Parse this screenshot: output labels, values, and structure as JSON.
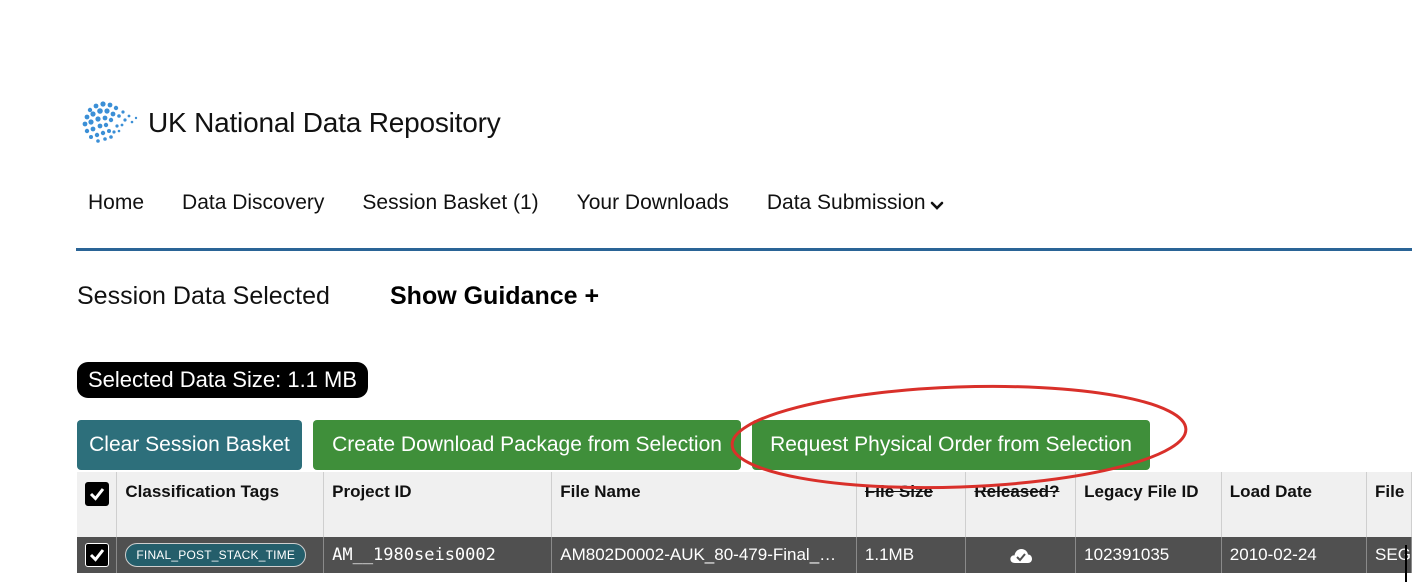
{
  "brand": {
    "title": "UK National Data Repository",
    "logo_icon": "nda-dots-logo-icon"
  },
  "nav": {
    "items": [
      {
        "label": "Home"
      },
      {
        "label": "Data Discovery"
      },
      {
        "label": "Session Basket (1)"
      },
      {
        "label": "Your Downloads"
      },
      {
        "label": "Data Submission"
      }
    ],
    "accent": "#2a6496"
  },
  "section": {
    "title": "Session Data Selected",
    "guidance": "Show Guidance +",
    "selected_size": "Selected Data Size: 1.1 MB"
  },
  "buttons": {
    "clear": "Clear Session Basket",
    "create": "Create Download Package from Selection",
    "physical": "Request Physical Order from Selection"
  },
  "table": {
    "headers": [
      "Classification Tags",
      "Project ID",
      "File Name",
      "File Size",
      "Released?",
      "Legacy File ID",
      "Load Date",
      "File"
    ],
    "rows": [
      {
        "checked": true,
        "tag": "FINAL_POST_STACK_TIME",
        "project_id": "AM__1980seis0002",
        "file_name": "AM802D0002-AUK_80-479-Final_…",
        "file_size": "1.1MB",
        "released_icon": "cloud-check-icon",
        "legacy_file_id": "102391035",
        "load_date": "2010-02-24",
        "file": "SEG"
      }
    ]
  },
  "colors": {
    "clear_button": "#2d6f7b",
    "green_button": "#3f8f3a",
    "highlight_ellipse": "#d9302a",
    "row_bg": "#505050"
  }
}
